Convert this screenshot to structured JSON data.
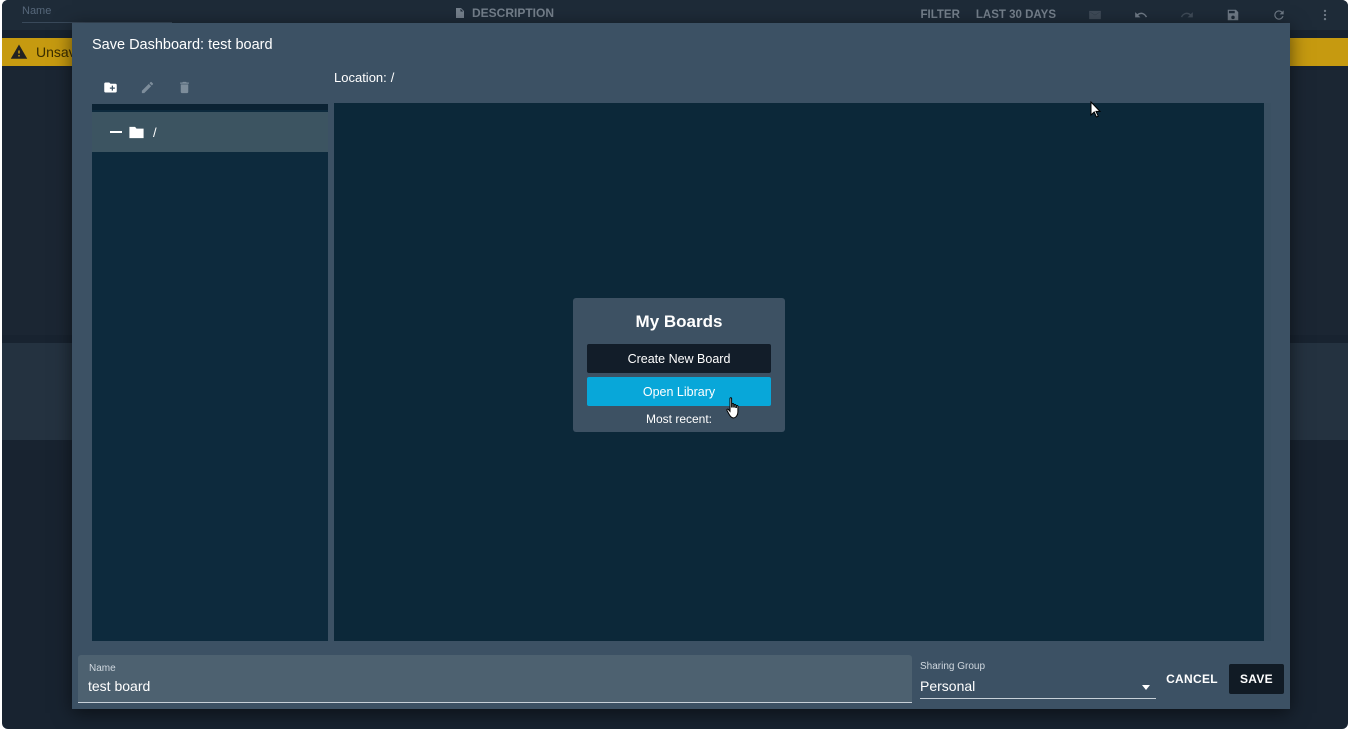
{
  "topbar": {
    "name_placeholder": "Name",
    "description_label": "DESCRIPTION",
    "filter_label": "FILTER",
    "range_label": "LAST 30 DAYS"
  },
  "warning": {
    "text": "Unsav"
  },
  "dialog": {
    "title": "Save Dashboard: test board",
    "location_label": "Location:",
    "location_value": "/",
    "tree": {
      "root_label": "/"
    },
    "boards": {
      "title": "My Boards",
      "create_label": "Create New Board",
      "open_label": "Open Library",
      "recent_label": "Most recent:"
    },
    "name_field": {
      "label": "Name",
      "value": "test board"
    },
    "sharing_field": {
      "label": "Sharing Group",
      "value": "Personal"
    },
    "cancel_label": "CANCEL",
    "save_label": "SAVE"
  },
  "colors": {
    "accent": "#08a7d9",
    "dialog_bg": "#3c5164",
    "panel_bg": "#0c2839",
    "warning": "#c69a10"
  }
}
